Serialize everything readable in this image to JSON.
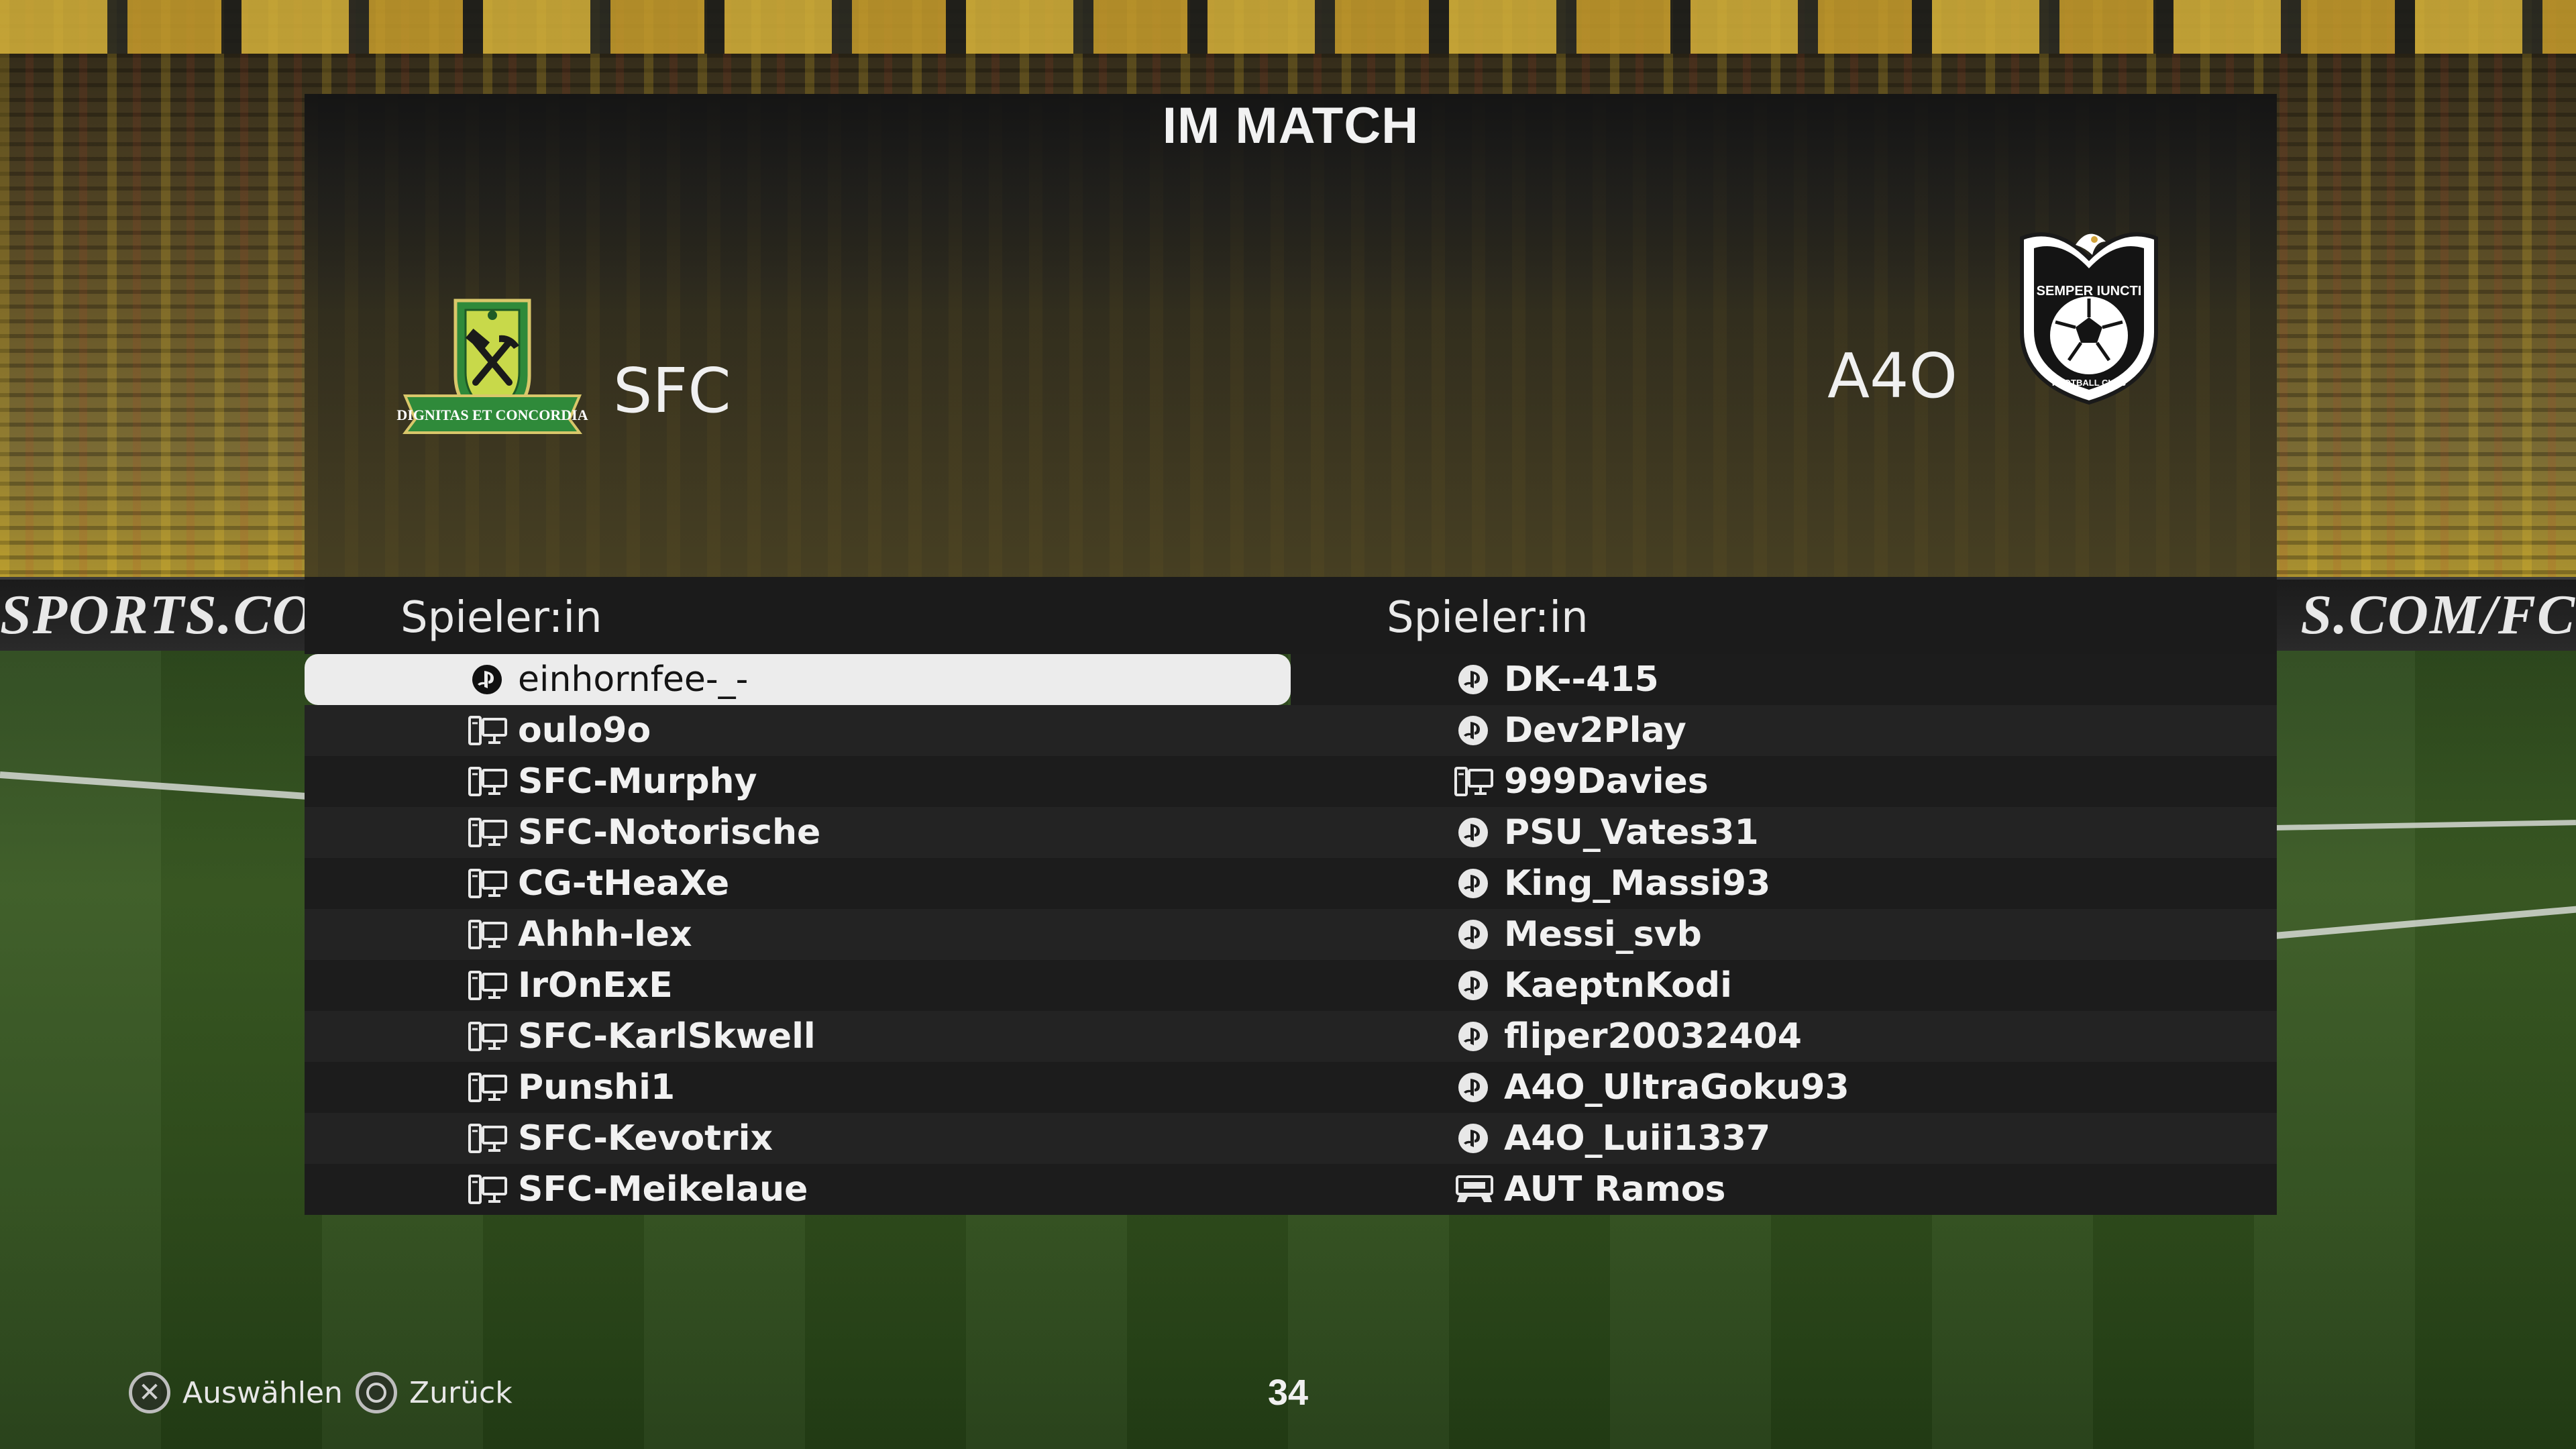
{
  "screen": {
    "title": "IM MATCH"
  },
  "background": {
    "adboard_left": "SPORTS.COM/FC",
    "adboard_right": "S.COM/FC"
  },
  "teams": {
    "home": {
      "name": "SFC",
      "crest_icon": "sfc-crest-icon",
      "crest_motto": "DIGNITAS ET CONCORDIA"
    },
    "away": {
      "name": "A4O",
      "crest_icon": "a4o-crest-icon",
      "crest_motto": "SEMPER IUNCTI",
      "crest_sub": "FOOTBALL CLUB"
    }
  },
  "columns": {
    "left_header": "Spieler:in",
    "right_header": "Spieler:in"
  },
  "players_home": [
    {
      "name": "einhornfee-_-",
      "platform": "playstation-icon",
      "selected": true
    },
    {
      "name": "oulo9o",
      "platform": "pc-icon"
    },
    {
      "name": "SFC-Murphy",
      "platform": "pc-icon"
    },
    {
      "name": "SFC-Notorische",
      "platform": "pc-icon"
    },
    {
      "name": "CG-tHeaXe",
      "platform": "pc-icon"
    },
    {
      "name": "Ahhh-lex",
      "platform": "pc-icon"
    },
    {
      "name": "IrOnExE",
      "platform": "pc-icon"
    },
    {
      "name": "SFC-KarlSkwell",
      "platform": "pc-icon"
    },
    {
      "name": "Punshi1",
      "platform": "pc-icon"
    },
    {
      "name": "SFC-Kevotrix",
      "platform": "pc-icon"
    },
    {
      "name": "SFC-Meikelaue",
      "platform": "pc-icon"
    }
  ],
  "players_away": [
    {
      "name": "DK--415",
      "platform": "playstation-icon"
    },
    {
      "name": "Dev2Play",
      "platform": "playstation-icon"
    },
    {
      "name": "999Davies",
      "platform": "pc-icon"
    },
    {
      "name": "PSU_Vates31",
      "platform": "playstation-icon"
    },
    {
      "name": "King_Massi93",
      "platform": "playstation-icon"
    },
    {
      "name": "Messi_svb",
      "platform": "playstation-icon"
    },
    {
      "name": "KaeptnKodi",
      "platform": "playstation-icon"
    },
    {
      "name": "fliper20032404",
      "platform": "playstation-icon"
    },
    {
      "name": "A4O_UltraGoku93",
      "platform": "playstation-icon"
    },
    {
      "name": "A4O_Luii1337",
      "platform": "playstation-icon"
    },
    {
      "name": "AUT Ramos",
      "platform": "cpu-icon"
    }
  ],
  "footer": {
    "select_label": "Auswählen",
    "select_icon": "cross-button-icon",
    "back_label": "Zurück",
    "back_icon": "circle-button-icon",
    "count": "34"
  },
  "colors": {
    "selected_row": "#ececec",
    "row_odd": "#1c1c1c",
    "row_even": "#232323"
  }
}
